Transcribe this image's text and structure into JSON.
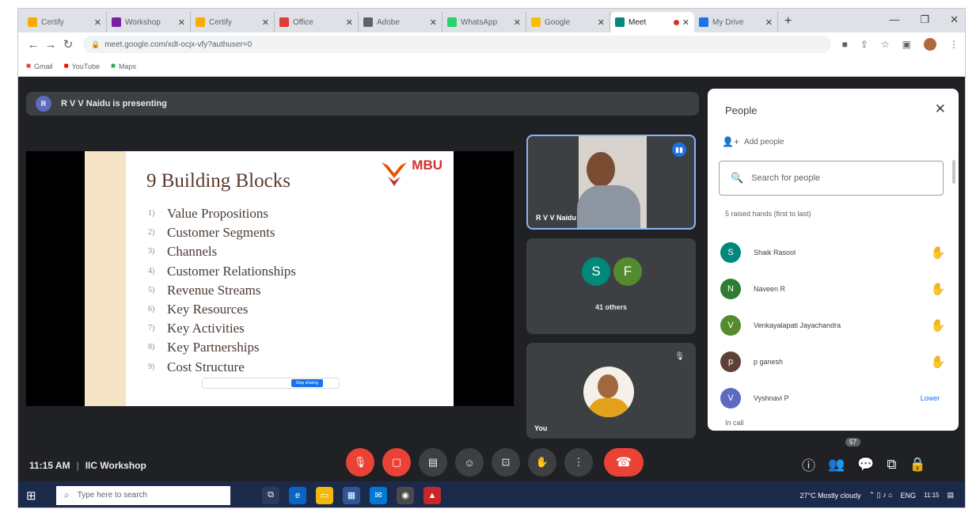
{
  "browser": {
    "tabs": [
      {
        "label": "Certify",
        "color": "#f9ab00"
      },
      {
        "label": "Workshop",
        "color": "#7b1fa2"
      },
      {
        "label": "Certify",
        "color": "#f9ab00"
      },
      {
        "label": "Office",
        "color": "#e53935"
      },
      {
        "label": "Adobe",
        "color": "#5f6368"
      },
      {
        "label": "WhatsApp",
        "color": "#25d366"
      },
      {
        "label": "Google",
        "color": "#fbbc04"
      },
      {
        "label": "Meet",
        "color": "#00897b",
        "active": true
      },
      {
        "label": "My Drive",
        "color": "#1a73e8"
      }
    ],
    "url": "meet.google.com/xdt-ocjx-vfy?authuser=0",
    "bookmarks": [
      {
        "label": "Gmail",
        "icon": "gmail-icon",
        "color": "#ea4335"
      },
      {
        "label": "YouTube",
        "icon": "youtube-icon",
        "color": "#ff0000"
      },
      {
        "label": "Maps",
        "icon": "maps-icon",
        "color": "#34a853"
      }
    ]
  },
  "meet": {
    "presenting_banner": "R V V Naidu is presenting",
    "presenter_initial": "R",
    "slide": {
      "title": "9 Building Blocks",
      "logo_text": "MBU",
      "items": [
        {
          "num": "1)",
          "text": "Value Propositions"
        },
        {
          "num": "2)",
          "text": "Customer Segments"
        },
        {
          "num": "3)",
          "text": "Channels"
        },
        {
          "num": "4)",
          "text": "Customer Relationships"
        },
        {
          "num": "5)",
          "text": "Revenue Streams"
        },
        {
          "num": "6)",
          "text": "Key Resources"
        },
        {
          "num": "7)",
          "text": "Key Activities"
        },
        {
          "num": "8)",
          "text": "Key Partnerships"
        },
        {
          "num": "9)",
          "text": "Cost Structure"
        }
      ],
      "share_bar_button": "Stop sharing"
    },
    "tiles": {
      "presenter_name": "R V V Naidu",
      "others_initials": [
        "S",
        "F"
      ],
      "others_label": "41 others",
      "self_label": "You"
    },
    "meeting_time": "11:15 AM",
    "meeting_name": "IIC Workshop",
    "people_count": "57"
  },
  "people_panel": {
    "title": "People",
    "add_people": "Add people",
    "search_placeholder": "Search for people",
    "raised_hands_header": "5 raised hands (first to last)",
    "people": [
      {
        "initial": "S",
        "name": "Shaik Rasool",
        "color": "#00897b",
        "action": "hand"
      },
      {
        "initial": "N",
        "name": "Naveen R",
        "color": "#2e7d32",
        "action": "hand"
      },
      {
        "initial": "V",
        "name": "Venkayalapati Jayachandra",
        "color": "#558b2f",
        "action": "hand"
      },
      {
        "initial": "p",
        "name": "p ganesh",
        "color": "#5d4037",
        "action": "hand"
      },
      {
        "initial": "V",
        "name": "Vyshnavi P",
        "color": "#5c6bc0",
        "action": "lower",
        "action_label": "Lower"
      }
    ],
    "in_call_label": "In call"
  },
  "taskbar": {
    "search_placeholder": "Type here to search",
    "weather": "27°C Mostly cloudy",
    "lang": "ENG",
    "time": "11:15"
  }
}
